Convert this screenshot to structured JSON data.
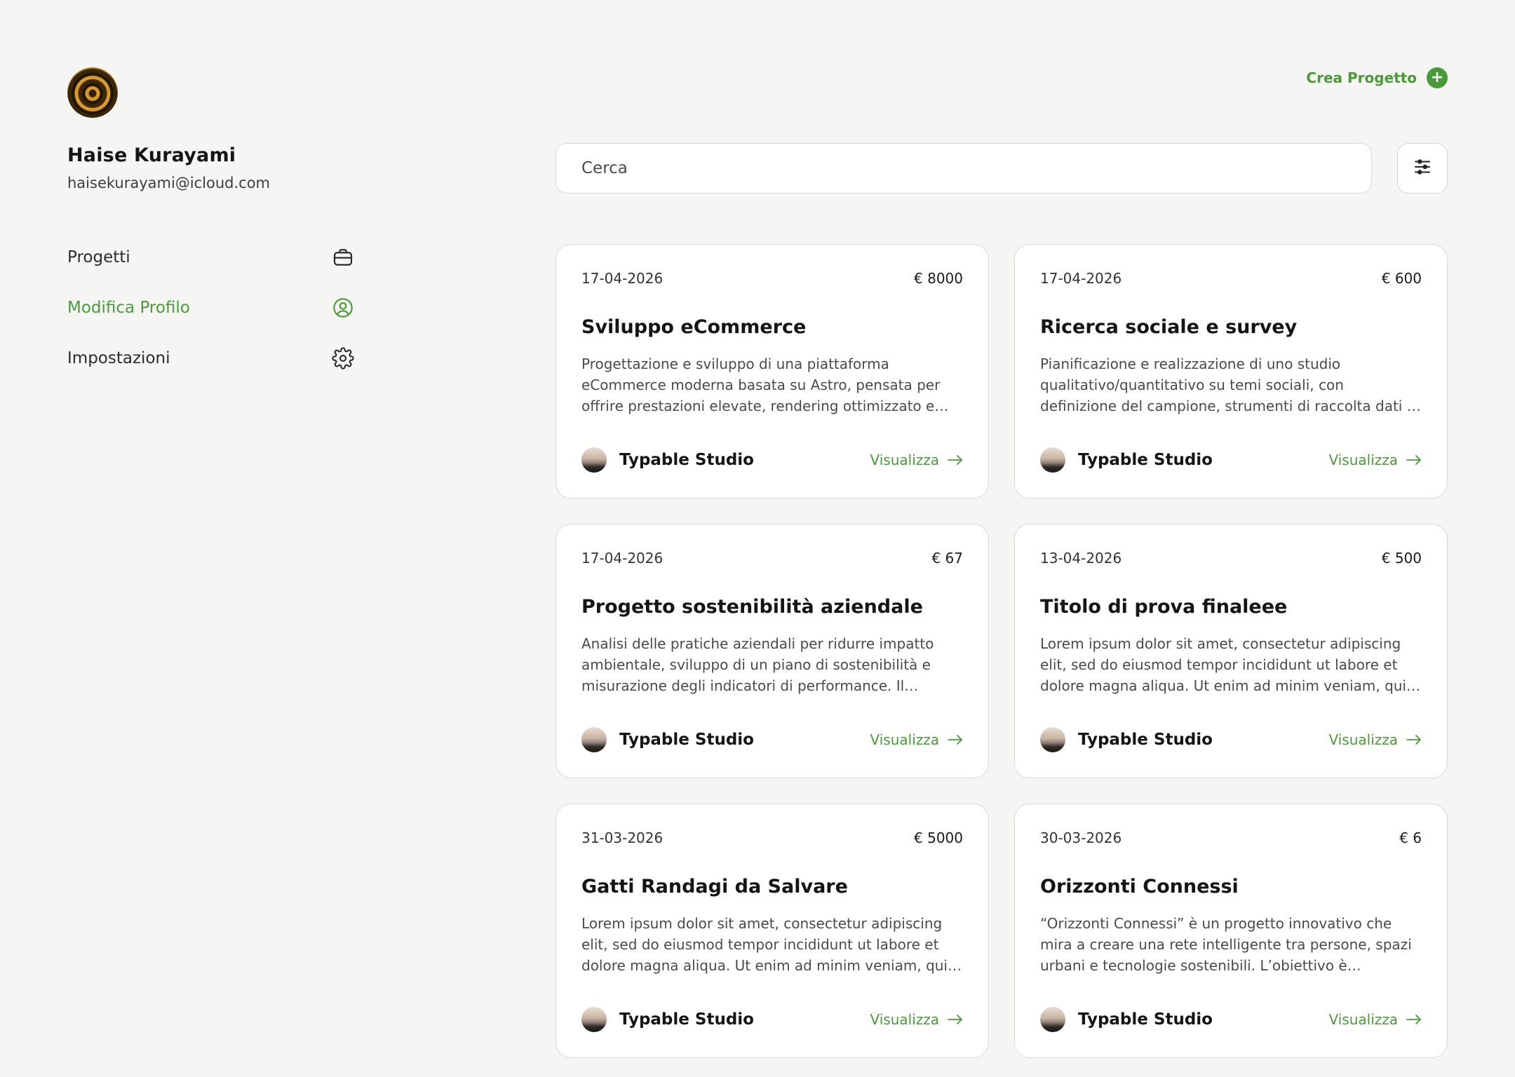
{
  "user": {
    "name": "Haise Kurayami",
    "email": "haisekurayami@icloud.com"
  },
  "nav": [
    {
      "label": "Progetti",
      "icon": "briefcase-icon",
      "active": false
    },
    {
      "label": "Modifica Profilo",
      "icon": "user-circle-icon",
      "active": true
    },
    {
      "label": "Impostazioni",
      "icon": "gear-icon",
      "active": false
    }
  ],
  "header": {
    "create_label": "Crea Progetto",
    "create_icon": "plus-icon"
  },
  "search": {
    "placeholder": "Cerca"
  },
  "colors": {
    "accent": "#4a9a3a",
    "background": "#f5f6f3"
  },
  "projects": [
    {
      "date": "17-04-2026",
      "price": "€ 8000",
      "title": "Sviluppo eCommerce",
      "description": "Progettazione e sviluppo di una piattaforma eCommerce moderna basata su Astro, pensata per offrire prestazioni elevate, rendering ottimizzato e un...",
      "author": "Typable Studio",
      "action": "Visualizza"
    },
    {
      "date": "17-04-2026",
      "price": "€ 600",
      "title": "Ricerca sociale e survey",
      "description": "Pianificazione e realizzazione di uno studio qualitativo/quantitativo su temi sociali, con definizione del campione, strumenti di raccolta dati e analisi dei...",
      "author": "Typable Studio",
      "action": "Visualizza"
    },
    {
      "date": "17-04-2026",
      "price": "€ 67",
      "title": "Progetto sostenibilità aziendale",
      "description": "Analisi delle pratiche aziendali per ridurre impatto ambientale, sviluppo di un piano di sostenibilità e misurazione degli indicatori di performance. Il progett...",
      "author": "Typable Studio",
      "action": "Visualizza"
    },
    {
      "date": "13-04-2026",
      "price": "€ 500",
      "title": "Titolo di prova finaleee",
      "description": "Lorem ipsum dolor sit amet, consectetur adipiscing elit, sed do eiusmod tempor incididunt ut labore et dolore magna aliqua. Ut enim ad minim veniam, quis nostrud...",
      "author": "Typable Studio",
      "action": "Visualizza"
    },
    {
      "date": "31-03-2026",
      "price": "€ 5000",
      "title": "Gatti Randagi da Salvare",
      "description": "Lorem ipsum dolor sit amet, consectetur adipiscing elit, sed do eiusmod tempor incididunt ut labore et dolore magna aliqua. Ut enim ad minim veniam, quis nostrud...",
      "author": "Typable Studio",
      "action": "Visualizza"
    },
    {
      "date": "30-03-2026",
      "price": "€ 6",
      "title": "Orizzonti Connessi",
      "description": "“Orizzonti Connessi” è un progetto innovativo che mira a creare una rete intelligente tra persone, spazi urbani e tecnologie sostenibili. L’obiettivo è trasformare le...",
      "author": "Typable Studio",
      "action": "Visualizza"
    }
  ]
}
